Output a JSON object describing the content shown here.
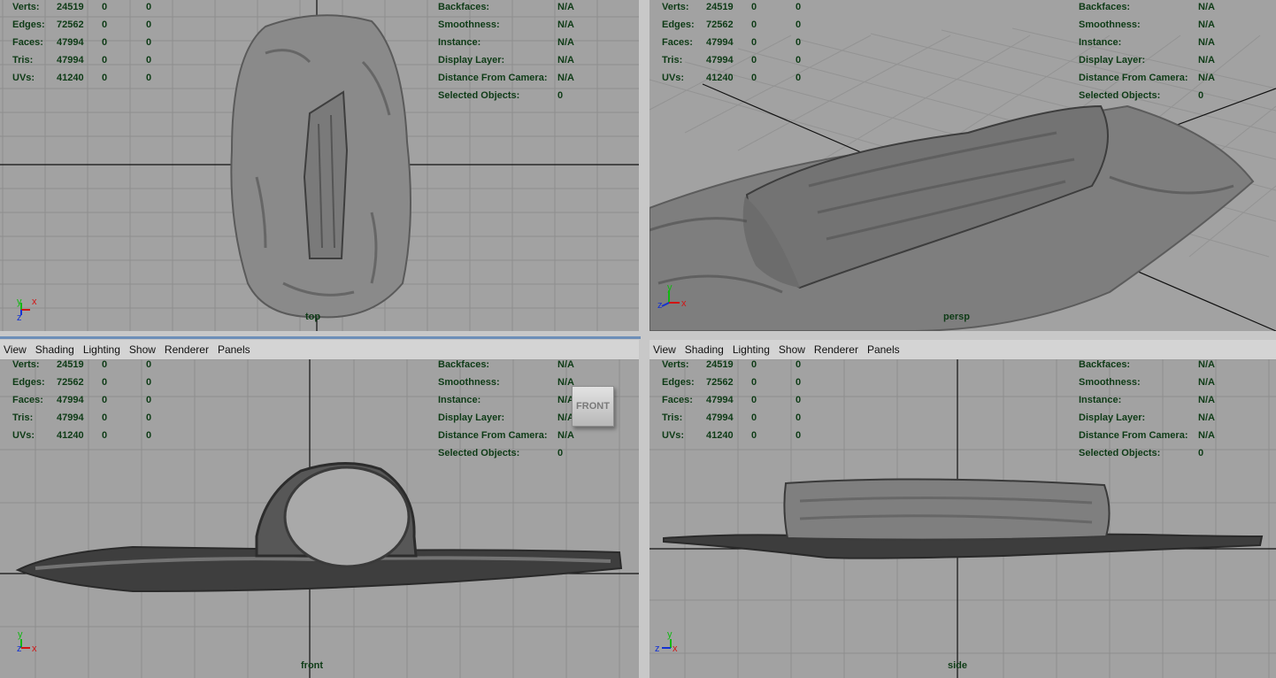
{
  "menu": [
    "View",
    "Shading",
    "Lighting",
    "Show",
    "Renderer",
    "Panels"
  ],
  "stats": {
    "rows": [
      {
        "label": "Verts:",
        "v1": "24519",
        "v2": "0",
        "v3": "0"
      },
      {
        "label": "Edges:",
        "v1": "72562",
        "v2": "0",
        "v3": "0"
      },
      {
        "label": "Faces:",
        "v1": "47994",
        "v2": "0",
        "v3": "0"
      },
      {
        "label": "Tris:",
        "v1": "47994",
        "v2": "0",
        "v3": "0"
      },
      {
        "label": "UVs:",
        "v1": "41240",
        "v2": "0",
        "v3": "0"
      }
    ],
    "info": [
      {
        "label": "Backfaces:",
        "value": "N/A"
      },
      {
        "label": "Smoothness:",
        "value": "N/A"
      },
      {
        "label": "Instance:",
        "value": "N/A"
      },
      {
        "label": "Display Layer:",
        "value": "N/A"
      },
      {
        "label": "Distance From Camera:",
        "value": "N/A"
      },
      {
        "label": "Selected Objects:",
        "value": "0"
      }
    ]
  },
  "viewports": {
    "top": {
      "camera": "top"
    },
    "persp": {
      "camera": "persp"
    },
    "front": {
      "camera": "front",
      "viewcube": "FRONT"
    },
    "side": {
      "camera": "side"
    }
  },
  "axis_labels": {
    "x": "x",
    "y": "y",
    "z": "z"
  },
  "colors": {
    "viewport_bg": "#a2a2a2",
    "grid": "#8c8c8c",
    "axis_line": "#111111",
    "hud_text": "#0e3b16",
    "mesh": "#7d7d7d",
    "axis_x": "#d21414",
    "axis_y": "#12b812",
    "axis_z": "#1432d2"
  }
}
